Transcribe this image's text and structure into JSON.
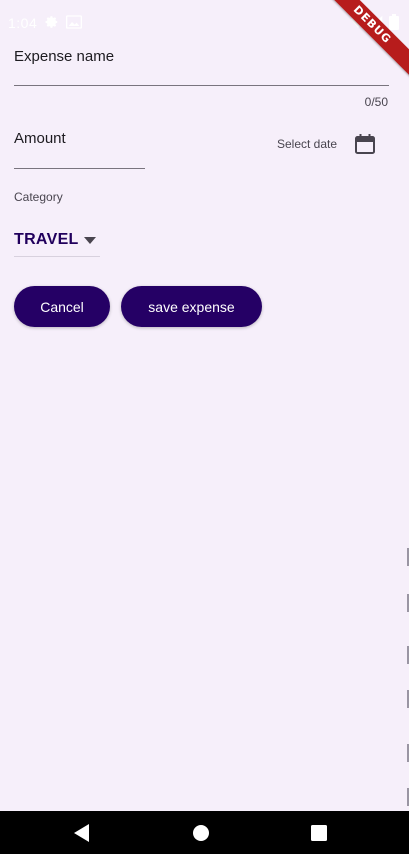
{
  "status_bar": {
    "time": "1:04",
    "icons": [
      "settings-icon",
      "image-icon",
      "wifi-icon",
      "signal-icon",
      "battery-icon"
    ]
  },
  "debug_banner": {
    "label": "DEBUG"
  },
  "form": {
    "expense_name": {
      "label": "Expense name",
      "value": "",
      "counter": "0/50"
    },
    "amount": {
      "label": "Amount",
      "value": ""
    },
    "date": {
      "label": "Select date",
      "icon": "calendar-icon"
    },
    "category": {
      "label": "Category",
      "selected": "TRAVEL"
    }
  },
  "actions": {
    "cancel_label": "Cancel",
    "save_label": "save expense"
  },
  "colors": {
    "background": "#f6effa",
    "button": "#250065",
    "category_text": "#21005d",
    "debug_banner": "#b71c1c"
  },
  "nav_bar": {
    "icons": [
      "back-icon",
      "home-icon",
      "recents-icon"
    ]
  }
}
